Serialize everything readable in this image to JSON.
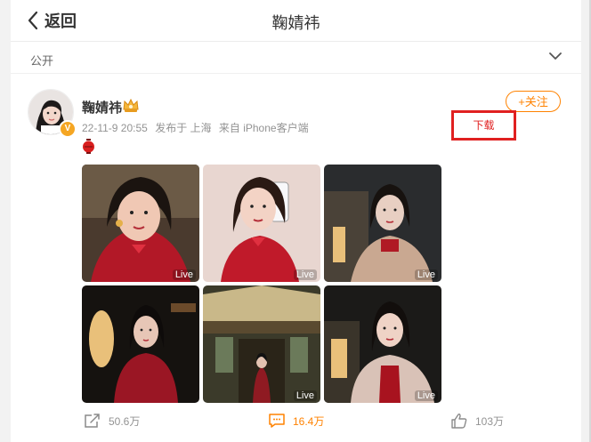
{
  "header": {
    "back_label": "返回",
    "title": "鞠婧祎"
  },
  "visibility": {
    "label": "公开"
  },
  "post": {
    "username": "鞠婧祎",
    "time": "22-11-9 20:55",
    "location": "发布于 上海",
    "source": "来自 iPhone客户端",
    "follow_label": "+关注",
    "download_label": "下载",
    "photos": [
      {
        "badge": "Live",
        "palette": [
          "#b21827",
          "#3a1a14",
          "#f0c8b4"
        ]
      },
      {
        "badge": "Live",
        "palette": [
          "#c01a2a",
          "#e8d6d0",
          "#f3d3c5"
        ]
      },
      {
        "badge": "Live",
        "palette": [
          "#2a2c2e",
          "#c9a891",
          "#e8cfc2"
        ]
      },
      {
        "badge": "",
        "palette": [
          "#15120f",
          "#9a1624",
          "#e9c07a"
        ]
      },
      {
        "badge": "Live",
        "palette": [
          "#3b3a2a",
          "#8f1a22",
          "#c9b889"
        ]
      },
      {
        "badge": "Live",
        "palette": [
          "#1b1a18",
          "#d9c2b7",
          "#a8131f"
        ]
      }
    ]
  },
  "actions": {
    "repost_count": "50.6万",
    "comment_count": "16.4万",
    "like_count": "103万"
  },
  "colors": {
    "accent": "#ff8200",
    "highlight": "#e02020"
  }
}
